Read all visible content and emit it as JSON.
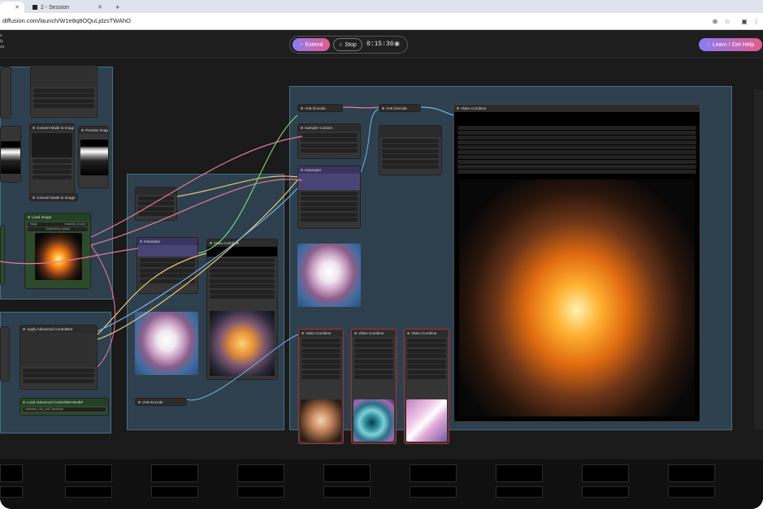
{
  "browser": {
    "tabs": [
      {
        "label": ""
      },
      {
        "label": "2 - Session"
      }
    ],
    "new_tab": "+",
    "url": "diffusion.com/launch/W1e8q8OQuLjdzsTWAhO"
  },
  "header": {
    "left_labels": [
      "s",
      "ty",
      "ox"
    ],
    "extend_label": "Extend",
    "stop_label": "Stop",
    "timer": "0:15:36",
    "help_label": "Learn / Get Help"
  },
  "nodes": {
    "vae_encode": "VAE Encode",
    "vae_decode": "VAE Decode",
    "sampler_custom": "Sampler Custom",
    "ksampler": "KSampler",
    "video_combine": "Video Combine",
    "load_image": "Load Image",
    "preview_image": "Preview Image",
    "apply_controlnet": "Apply Advanced ControlNet",
    "load_controlnet": "Load Advanced ControlNet Model",
    "upload_label": "choose file to upload",
    "image_file": "explosion_(1).png",
    "controlnet_file": "controlnet_v11p_sd15_lineart.pth",
    "convert_mask": "Convert Mask to Image",
    "vae_encode_bottom": "VAE Encode"
  },
  "colors": {
    "accent_start": "#8a7cf5",
    "accent_end": "#e25b8b",
    "group_blue": "#466e8c"
  }
}
